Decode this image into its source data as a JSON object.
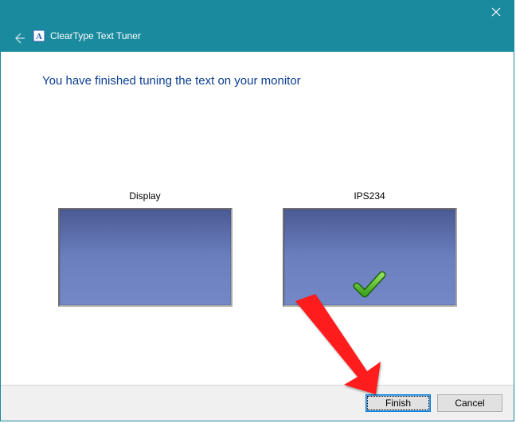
{
  "window": {
    "title": "ClearType Text Tuner"
  },
  "heading": "You have finished tuning the text on your monitor",
  "monitors": {
    "left": {
      "label": "Display",
      "selected": false
    },
    "right": {
      "label": "IPS234",
      "selected": true
    }
  },
  "buttons": {
    "finish": "Finish",
    "cancel": "Cancel"
  }
}
